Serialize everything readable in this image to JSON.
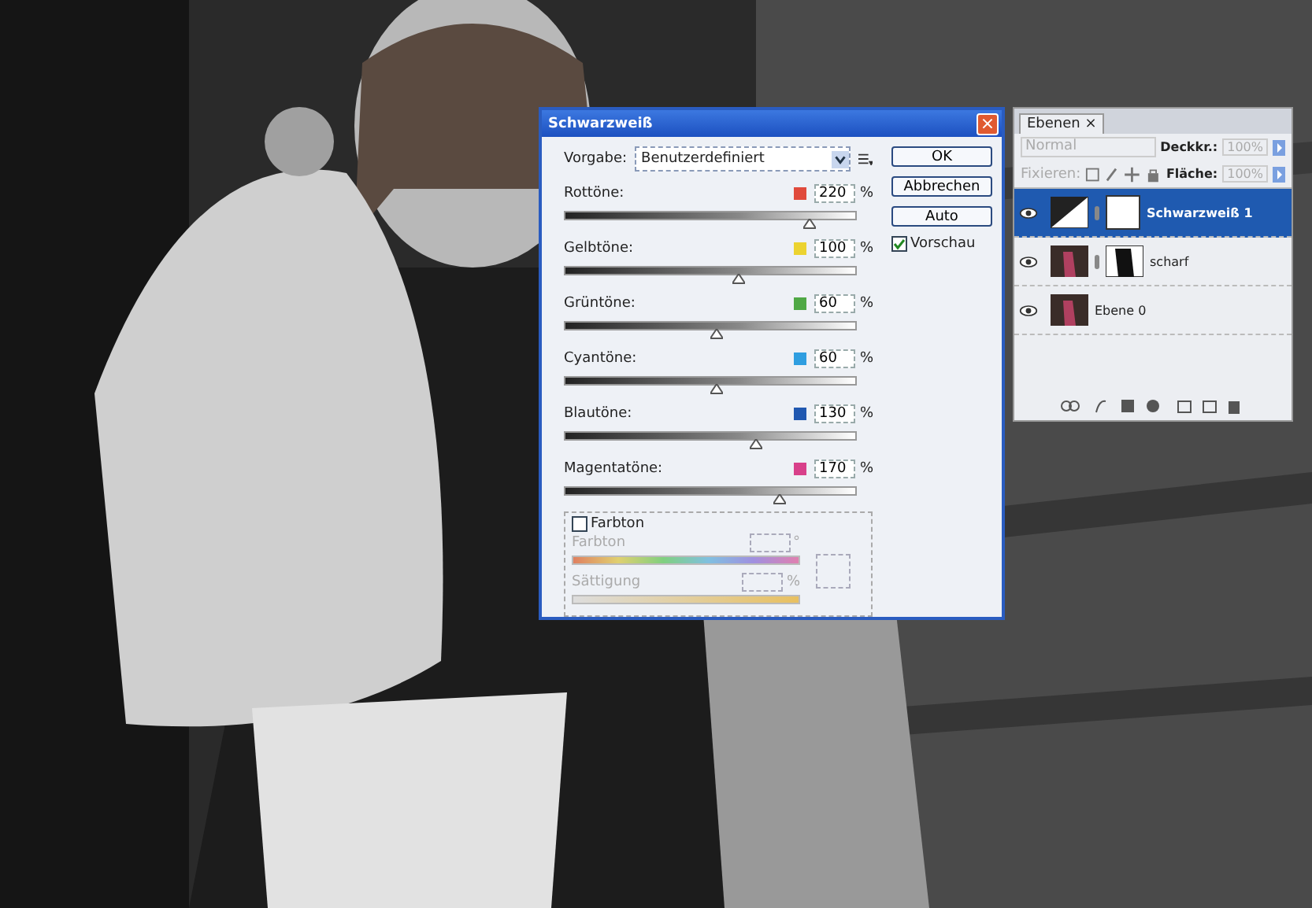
{
  "dialog": {
    "title": "Schwarzweiß",
    "close": "×",
    "preset_label": "Vorgabe:",
    "preset_value": "Benutzerdefiniert",
    "channels": [
      {
        "name": "Rottöne:",
        "color": "#e04a3c",
        "value": "220",
        "unit": "%",
        "level": 0.84
      },
      {
        "name": "Gelbtöne:",
        "color": "#ecd330",
        "value": "100",
        "unit": "%",
        "level": 0.6
      },
      {
        "name": "Grüntöne:",
        "color": "#4fa845",
        "value": "60",
        "unit": "%",
        "level": 0.52
      },
      {
        "name": "Cyantöne:",
        "color": "#2f9ee0",
        "value": "60",
        "unit": "%",
        "level": 0.52
      },
      {
        "name": "Blautöne:",
        "color": "#2058b0",
        "value": "130",
        "unit": "%",
        "level": 0.66
      },
      {
        "name": "Magentatöne:",
        "color": "#d8408a",
        "value": "170",
        "unit": "%",
        "level": 0.74
      }
    ],
    "buttons": [
      "OK",
      "Abbrechen",
      "Auto"
    ],
    "preview": {
      "label": "Vorschau",
      "checked": true
    },
    "tint": {
      "label": "Farbton",
      "checked": false,
      "hue_label": "Farbton",
      "hue_unit": "°",
      "saturation_label": "Sättigung",
      "saturation_unit": "%"
    }
  },
  "layers_panel": {
    "tab": "Ebenen",
    "tab_close": "×",
    "blend_mode": "Normal",
    "opacity_label": "Deckkr.:",
    "opacity": "100%",
    "lock_label": "Fixieren:",
    "fill_label": "Fläche:",
    "fill": "100%",
    "layers": [
      {
        "name": "Schwarzweiß 1",
        "kind": "adjustment",
        "selected": true,
        "visible": true
      },
      {
        "name": "scharf",
        "kind": "masked",
        "selected": false,
        "visible": true
      },
      {
        "name": "Ebene 0",
        "selected": false,
        "visible": true
      }
    ]
  }
}
